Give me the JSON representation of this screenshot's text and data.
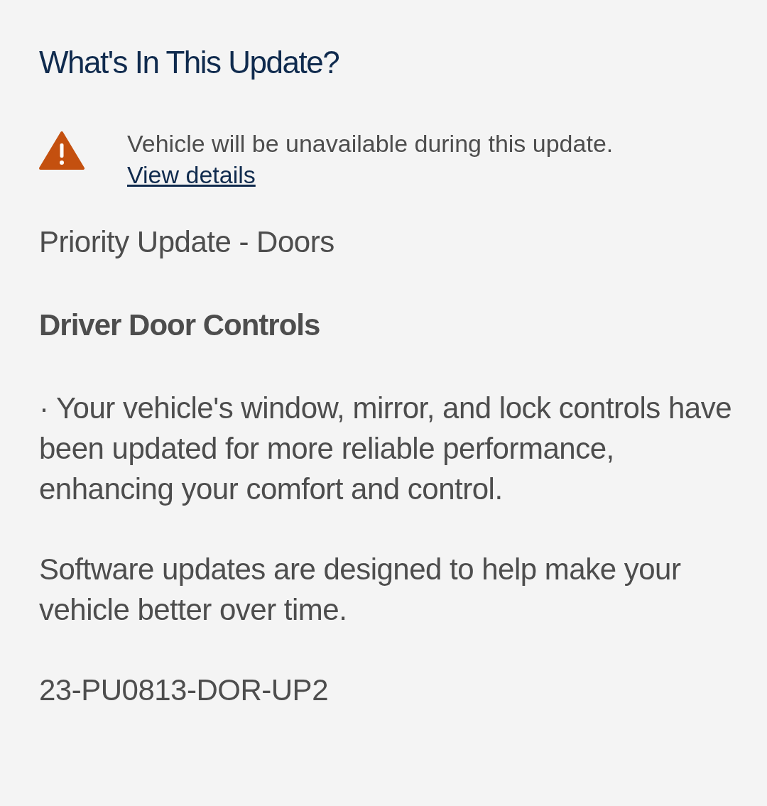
{
  "title": "What's In This Update?",
  "warning": {
    "message": "Vehicle will be unavailable during this update.",
    "link": "View details"
  },
  "update_name": "Priority Update - Doors",
  "section_heading": "Driver Door Controls",
  "bullets": [
    "· Your vehicle's window, mirror, and lock controls have been updated for more reliable performance, enhancing your comfort and control."
  ],
  "note": "Software updates are designed to help make your vehicle better over time.",
  "code": "23-PU0813-DOR-UP2"
}
